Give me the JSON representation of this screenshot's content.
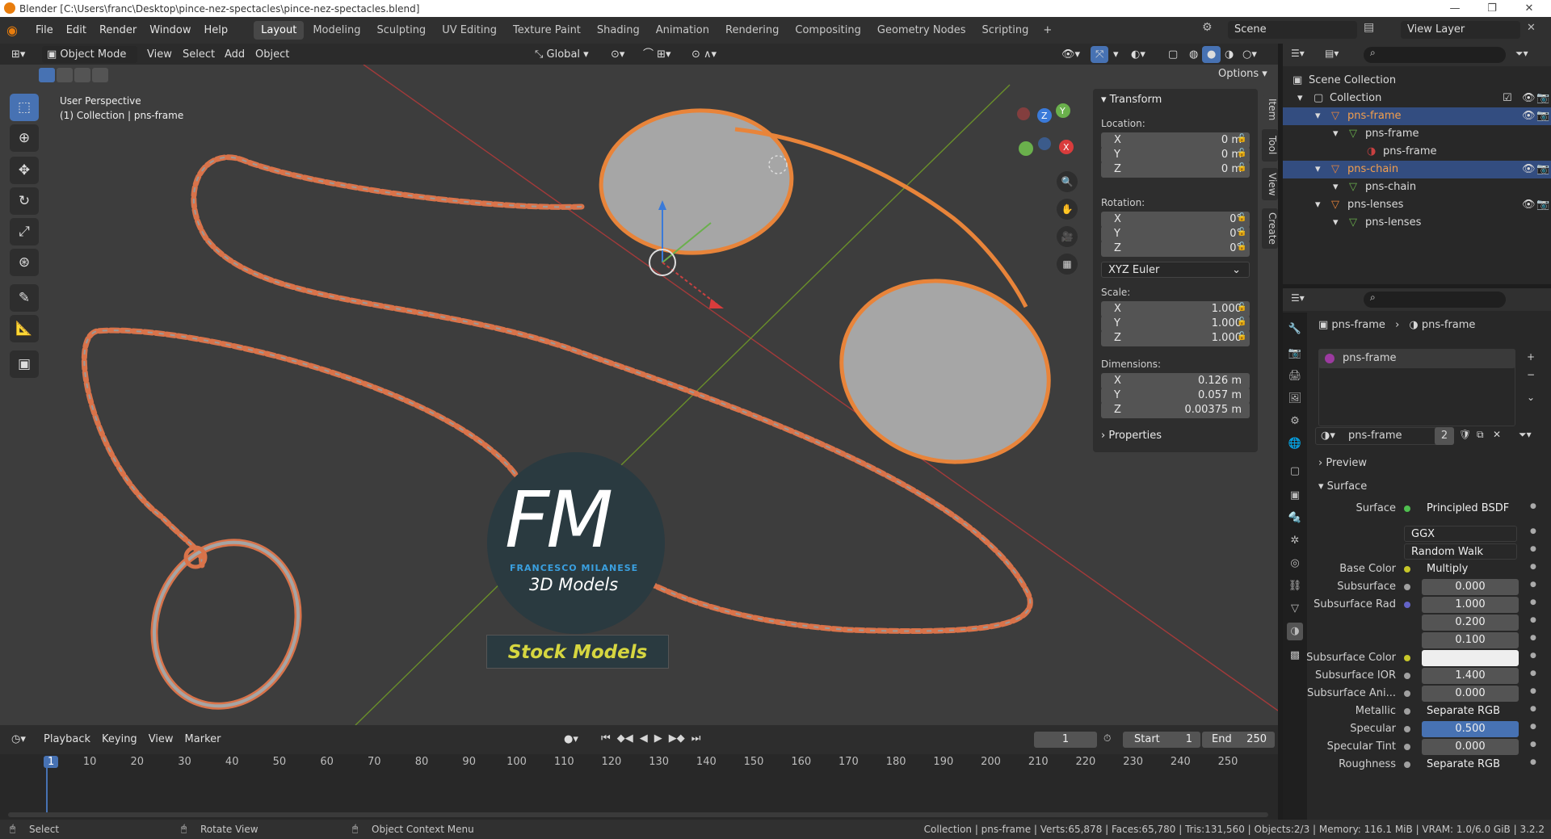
{
  "window": {
    "title": "Blender [C:\\Users\\franc\\Desktop\\pince-nez-spectacles\\pince-nez-spectacles.blend]",
    "minimize": "—",
    "maximize": "❐",
    "close": "✕"
  },
  "menu": [
    "File",
    "Edit",
    "Render",
    "Window",
    "Help"
  ],
  "workspaces": [
    "Layout",
    "Modeling",
    "Sculpting",
    "UV Editing",
    "Texture Paint",
    "Shading",
    "Animation",
    "Rendering",
    "Compositing",
    "Geometry Nodes",
    "Scripting"
  ],
  "workspace_add": "+",
  "scene": "Scene",
  "view_layer": "View Layer",
  "viewport_header": {
    "mode": "Object Mode",
    "menus": [
      "View",
      "Select",
      "Add",
      "Object"
    ],
    "orientation": "Global",
    "options": "Options"
  },
  "viewport": {
    "perspective": "User Perspective",
    "collection_line": "(1) Collection | pns-frame",
    "watermark_letters": "FM",
    "watermark_name": "FRANCESCO MILANESE",
    "watermark_sub": "3D Models",
    "watermark_banner": "Stock Models",
    "gizmo_axes": [
      "X",
      "Y",
      "Z"
    ]
  },
  "npanel": {
    "transform_title": "Transform",
    "location_label": "Location:",
    "location": [
      {
        "axis": "X",
        "value": "0 m"
      },
      {
        "axis": "Y",
        "value": "0 m"
      },
      {
        "axis": "Z",
        "value": "0 m"
      }
    ],
    "rotation_label": "Rotation:",
    "rotation": [
      {
        "axis": "X",
        "value": "0°"
      },
      {
        "axis": "Y",
        "value": "0°"
      },
      {
        "axis": "Z",
        "value": "0°"
      }
    ],
    "rotation_mode": "XYZ Euler",
    "scale_label": "Scale:",
    "scale": [
      {
        "axis": "X",
        "value": "1.000"
      },
      {
        "axis": "Y",
        "value": "1.000"
      },
      {
        "axis": "Z",
        "value": "1.000"
      }
    ],
    "dimensions_label": "Dimensions:",
    "dimensions": [
      {
        "axis": "X",
        "value": "0.126 m"
      },
      {
        "axis": "Y",
        "value": "0.057 m"
      },
      {
        "axis": "Z",
        "value": "0.00375 m"
      }
    ],
    "properties_title": "Properties",
    "tabs": [
      "Item",
      "Tool",
      "View",
      "Create"
    ]
  },
  "outliner": {
    "rows": [
      {
        "label": "Scene Collection",
        "indent": 0
      },
      {
        "label": "Collection",
        "indent": 1
      },
      {
        "label": "pns-frame",
        "indent": 2
      },
      {
        "label": "pns-frame",
        "indent": 3
      },
      {
        "label": "pns-frame",
        "indent": 4
      },
      {
        "label": "pns-chain",
        "indent": 2
      },
      {
        "label": "pns-chain",
        "indent": 3
      },
      {
        "label": "pns-lenses",
        "indent": 2
      },
      {
        "label": "pns-lenses",
        "indent": 3
      }
    ]
  },
  "properties": {
    "breadcrumb_object": "pns-frame",
    "breadcrumb_material": "pns-frame",
    "slot": "pns-frame",
    "material_name": "pns-frame",
    "material_users": "2",
    "preview_label": "Preview",
    "surface_section": "Surface",
    "fields": [
      {
        "label": "Surface",
        "value": "Principled BSDF",
        "kind": "link",
        "dot": "#4fbf4f"
      },
      {
        "label": "",
        "value": "GGX",
        "kind": "drop"
      },
      {
        "label": "",
        "value": "Random Walk",
        "kind": "drop"
      },
      {
        "label": "Base Color",
        "value": "Multiply",
        "kind": "link",
        "dot": "#c7c729"
      },
      {
        "label": "Subsurface",
        "value": "0.000",
        "kind": "num",
        "dot": "#a0a0a0"
      },
      {
        "label": "Subsurface Rad",
        "value": "1.000",
        "kind": "num",
        "dot": "#6363c7"
      },
      {
        "label": "",
        "value": "0.200",
        "kind": "num"
      },
      {
        "label": "",
        "value": "0.100",
        "kind": "num"
      },
      {
        "label": "Subsurface Color",
        "value": "",
        "kind": "color",
        "dot": "#c7c729"
      },
      {
        "label": "Subsurface IOR",
        "value": "1.400",
        "kind": "num",
        "dot": "#a0a0a0"
      },
      {
        "label": "Subsurface Ani...",
        "value": "0.000",
        "kind": "num",
        "dot": "#a0a0a0"
      },
      {
        "label": "Metallic",
        "value": "Separate RGB",
        "kind": "link",
        "dot": "#a0a0a0"
      },
      {
        "label": "Specular",
        "value": "0.500",
        "kind": "num",
        "dot": "#a0a0a0"
      },
      {
        "label": "Specular Tint",
        "value": "0.000",
        "kind": "num",
        "dot": "#a0a0a0"
      },
      {
        "label": "Roughness",
        "value": "Separate RGB",
        "kind": "link",
        "dot": "#a0a0a0"
      }
    ]
  },
  "timeline": {
    "menus": [
      "Playback",
      "Keying",
      "View",
      "Marker"
    ],
    "current_frame": "1",
    "start_label": "Start",
    "start": "1",
    "end_label": "End",
    "end": "250",
    "ticks": [
      "1",
      "10",
      "20",
      "30",
      "40",
      "50",
      "60",
      "70",
      "80",
      "90",
      "100",
      "110",
      "120",
      "130",
      "140",
      "150",
      "160",
      "170",
      "180",
      "190",
      "200",
      "210",
      "220",
      "230",
      "240",
      "250"
    ]
  },
  "statusbar": {
    "select": "Select",
    "rotate": "Rotate View",
    "context": "Object Context Menu",
    "stats": "Collection | pns-frame | Verts:65,878 | Faces:65,780 | Tris:131,560 | Objects:2/3 | Memory: 116.1 MiB | VRAM: 1.0/6.0 GiB | 3.2.2"
  },
  "colors": {
    "accent": "#4772b3",
    "selection_orange": "#e8843a",
    "chain_color": "#d9734a"
  }
}
